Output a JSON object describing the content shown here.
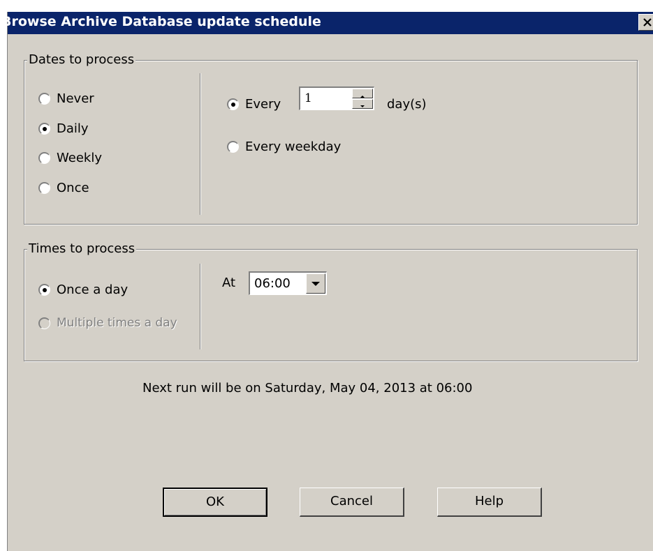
{
  "window": {
    "title": "Browse Archive Database update schedule"
  },
  "dates_group": {
    "legend": "Dates to process",
    "options": [
      {
        "label": "Never",
        "selected": false
      },
      {
        "label": "Daily",
        "selected": true
      },
      {
        "label": "Weekly",
        "selected": false
      },
      {
        "label": "Once",
        "selected": false
      }
    ],
    "every_label": "Every",
    "every_value": "1",
    "days_unit": "day(s)",
    "every_weekday_label": "Every weekday"
  },
  "times_group": {
    "legend": "Times to process",
    "once_a_day_label": "Once a day",
    "multiple_label": "Multiple times a day",
    "at_label": "At",
    "time_value": "06:00"
  },
  "next_run_text": "Next run will be on Saturday, May 04, 2013 at 06:00",
  "buttons": {
    "ok": "OK",
    "cancel": "Cancel",
    "help": "Help"
  },
  "colors": {
    "titlebar": "#0a246a",
    "face": "#d4d0c8"
  }
}
